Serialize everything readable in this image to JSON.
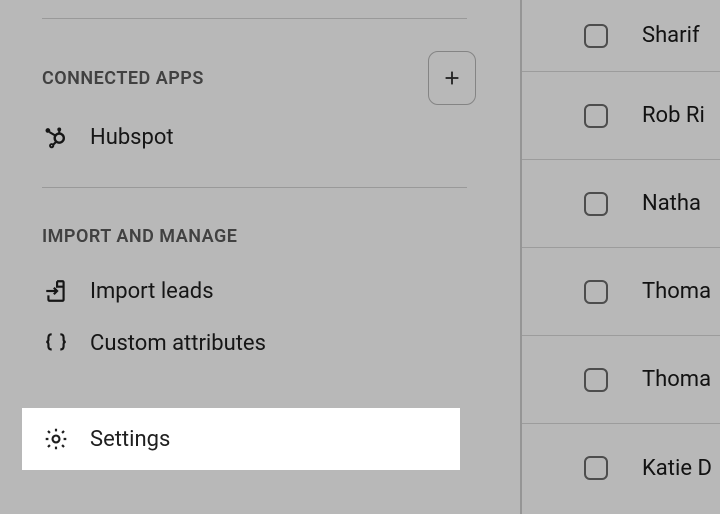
{
  "sidebar": {
    "connected_apps_title": "CONNECTED APPS",
    "hubspot_label": "Hubspot",
    "import_manage_title": "IMPORT AND MANAGE",
    "import_leads_label": "Import leads",
    "custom_attributes_label": "Custom attributes",
    "settings_label": "Settings"
  },
  "contacts": {
    "rows": [
      {
        "name": "Sharif"
      },
      {
        "name": "Rob Ri"
      },
      {
        "name": "Natha"
      },
      {
        "name": "Thoma"
      },
      {
        "name": "Thoma"
      },
      {
        "name": "Katie D"
      }
    ]
  }
}
